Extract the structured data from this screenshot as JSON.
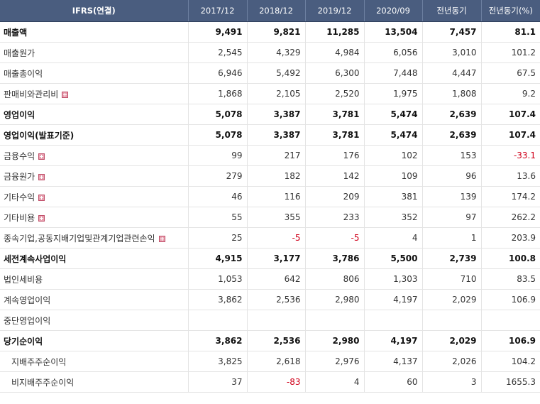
{
  "header": {
    "label": "IFRS(연결)",
    "columns": [
      "2017/12",
      "2018/12",
      "2019/12",
      "2020/09",
      "전년동기",
      "전년동기(%)"
    ]
  },
  "rows": [
    {
      "label": "매출액",
      "values": [
        "9,491",
        "9,821",
        "11,285",
        "13,504",
        "7,457",
        "81.1"
      ],
      "bold": true,
      "expandable": false
    },
    {
      "label": "매출원가",
      "values": [
        "2,545",
        "4,329",
        "4,984",
        "6,056",
        "3,010",
        "101.2"
      ],
      "bold": false,
      "expandable": false
    },
    {
      "label": "매출총이익",
      "values": [
        "6,946",
        "5,492",
        "6,300",
        "7,448",
        "4,447",
        "67.5"
      ],
      "bold": false,
      "expandable": false
    },
    {
      "label": "판매비와관리비",
      "values": [
        "1,868",
        "2,105",
        "2,520",
        "1,975",
        "1,808",
        "9.2"
      ],
      "bold": false,
      "expandable": true
    },
    {
      "label": "영업이익",
      "values": [
        "5,078",
        "3,387",
        "3,781",
        "5,474",
        "2,639",
        "107.4"
      ],
      "bold": true,
      "expandable": false
    },
    {
      "label": "영업이익(발표기준)",
      "values": [
        "5,078",
        "3,387",
        "3,781",
        "5,474",
        "2,639",
        "107.4"
      ],
      "bold": true,
      "expandable": false
    },
    {
      "label": "금융수익",
      "values": [
        "99",
        "217",
        "176",
        "102",
        "153",
        "-33.1"
      ],
      "bold": false,
      "expandable": true
    },
    {
      "label": "금융원가",
      "values": [
        "279",
        "182",
        "142",
        "109",
        "96",
        "13.6"
      ],
      "bold": false,
      "expandable": true
    },
    {
      "label": "기타수익",
      "values": [
        "46",
        "116",
        "209",
        "381",
        "139",
        "174.2"
      ],
      "bold": false,
      "expandable": true
    },
    {
      "label": "기타비용",
      "values": [
        "55",
        "355",
        "233",
        "352",
        "97",
        "262.2"
      ],
      "bold": false,
      "expandable": true
    },
    {
      "label": "종속기업,공동지배기업및관계기업관련손익",
      "values": [
        "25",
        "-5",
        "-5",
        "4",
        "1",
        "203.9"
      ],
      "bold": false,
      "expandable": true
    },
    {
      "label": "세전계속사업이익",
      "values": [
        "4,915",
        "3,177",
        "3,786",
        "5,500",
        "2,739",
        "100.8"
      ],
      "bold": true,
      "expandable": false
    },
    {
      "label": "법인세비용",
      "values": [
        "1,053",
        "642",
        "806",
        "1,303",
        "710",
        "83.5"
      ],
      "bold": false,
      "expandable": false
    },
    {
      "label": "계속영업이익",
      "values": [
        "3,862",
        "2,536",
        "2,980",
        "4,197",
        "2,029",
        "106.9"
      ],
      "bold": false,
      "expandable": false
    },
    {
      "label": "중단영업이익",
      "values": [
        "",
        "",
        "",
        "",
        "",
        ""
      ],
      "bold": false,
      "expandable": false
    },
    {
      "label": "당기순이익",
      "values": [
        "3,862",
        "2,536",
        "2,980",
        "4,197",
        "2,029",
        "106.9"
      ],
      "bold": true,
      "expandable": false
    },
    {
      "label": "지배주주순이익",
      "values": [
        "3,825",
        "2,618",
        "2,976",
        "4,137",
        "2,026",
        "104.2"
      ],
      "bold": false,
      "expandable": false,
      "sub": true
    },
    {
      "label": "비지배주주순이익",
      "values": [
        "37",
        "-83",
        "4",
        "60",
        "3",
        "1655.3"
      ],
      "bold": false,
      "expandable": false,
      "sub": true
    }
  ],
  "colors": {
    "header_bg": "#4a5d7f",
    "negative": "#d0021b",
    "expand_icon": "#e8a0b0"
  },
  "icons": {
    "expand": "plus-box-icon"
  }
}
